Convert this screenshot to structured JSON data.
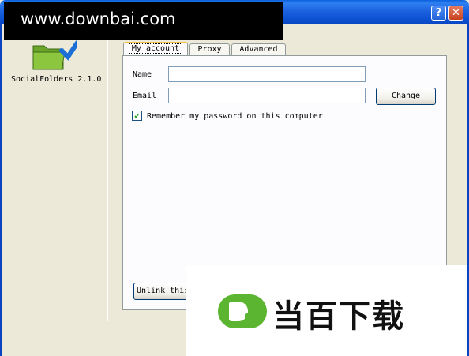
{
  "watermark_top": {
    "text": "www.downbai.com"
  },
  "window": {
    "help_label": "?",
    "close_label": "✕"
  },
  "sidebar": {
    "app_name": "SocialFolders 2.1.0",
    "icon": "folder-check-icon"
  },
  "tabs": [
    {
      "label": "My account",
      "active": true
    },
    {
      "label": "Proxy",
      "active": false
    },
    {
      "label": "Advanced",
      "active": false
    }
  ],
  "account": {
    "name_label": "Name",
    "name_value": "",
    "email_label": "Email",
    "email_value": "",
    "change_label": "Change",
    "remember_label": "Remember my password on this computer",
    "remember_checked": true,
    "checkmark": "✔",
    "unlink_label": "Unlink this computer"
  },
  "watermark_bottom": {
    "text": "当百下载"
  },
  "colors": {
    "titlebar": "#0b50d0",
    "window_bg": "#ece9d8",
    "panel_bg": "#fcfcfe",
    "tab_active_accent": "#f0c24c",
    "logo_green": "#5cb531"
  }
}
